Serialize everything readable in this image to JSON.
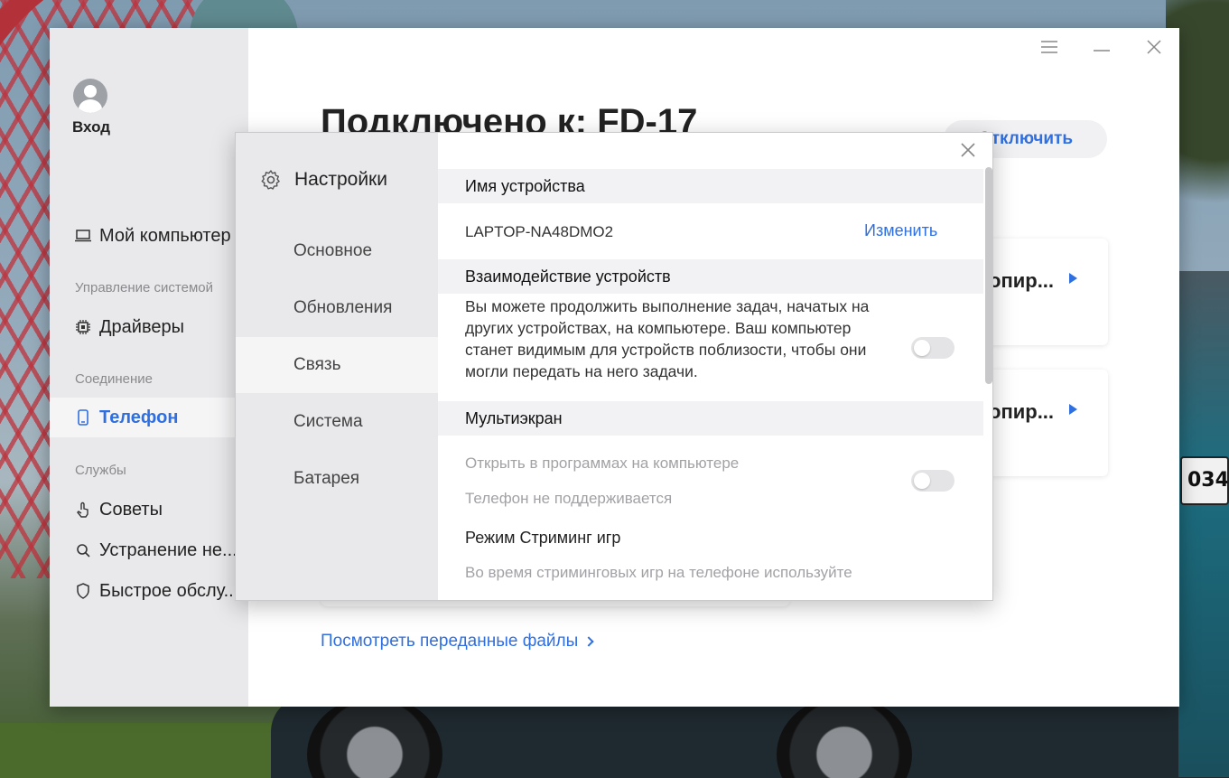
{
  "background": {
    "plate_text": "034"
  },
  "app": {
    "login": "Вход",
    "window_controls": {
      "menu": "menu-icon",
      "minimize": "minimize-icon",
      "close": "close-icon"
    },
    "sidebar": {
      "my_computer": "Мой компьютер",
      "section_system": "Управление системой",
      "drivers": "Драйверы",
      "section_connection": "Соединение",
      "phone": "Телефон",
      "section_services": "Службы",
      "tips": "Советы",
      "troubleshoot": "Устранение не...",
      "quick_service": "Быстрое обслу..."
    },
    "main": {
      "title": "Подключено к: FD-17",
      "disconnect": "Отключить",
      "card1": "опир...",
      "card2": "опир...",
      "files_link": "Посмотреть переданные файлы"
    },
    "accent_color": "#2f6fe0"
  },
  "dialog": {
    "title": "Настройки",
    "nav": [
      "Основное",
      "Обновления",
      "Связь",
      "Система",
      "Батарея"
    ],
    "active_nav": "Связь",
    "sections": {
      "device_name_header": "Имя устройства",
      "device_name_value": "LAPTOP-NA48DMO2",
      "change": "Изменить",
      "interaction_header": "Взаимодействие устройств",
      "interaction_text": "Вы можете продолжить выполнение задач, начатых на других устройствах, на компьютере. Ваш компьютер станет видимым для устройств поблизости, чтобы они могли передать на него задачи.",
      "multiscreen_header": "Мультиэкран",
      "open_in_apps": "Открыть в программах на компьютере",
      "phone_unsupported": "Телефон не поддерживается",
      "game_streaming": "Режим Стриминг игр",
      "game_streaming_text": "Во время стриминговых игр на телефоне используйте"
    },
    "toggles": {
      "interaction": false,
      "open_in_apps": false
    }
  }
}
